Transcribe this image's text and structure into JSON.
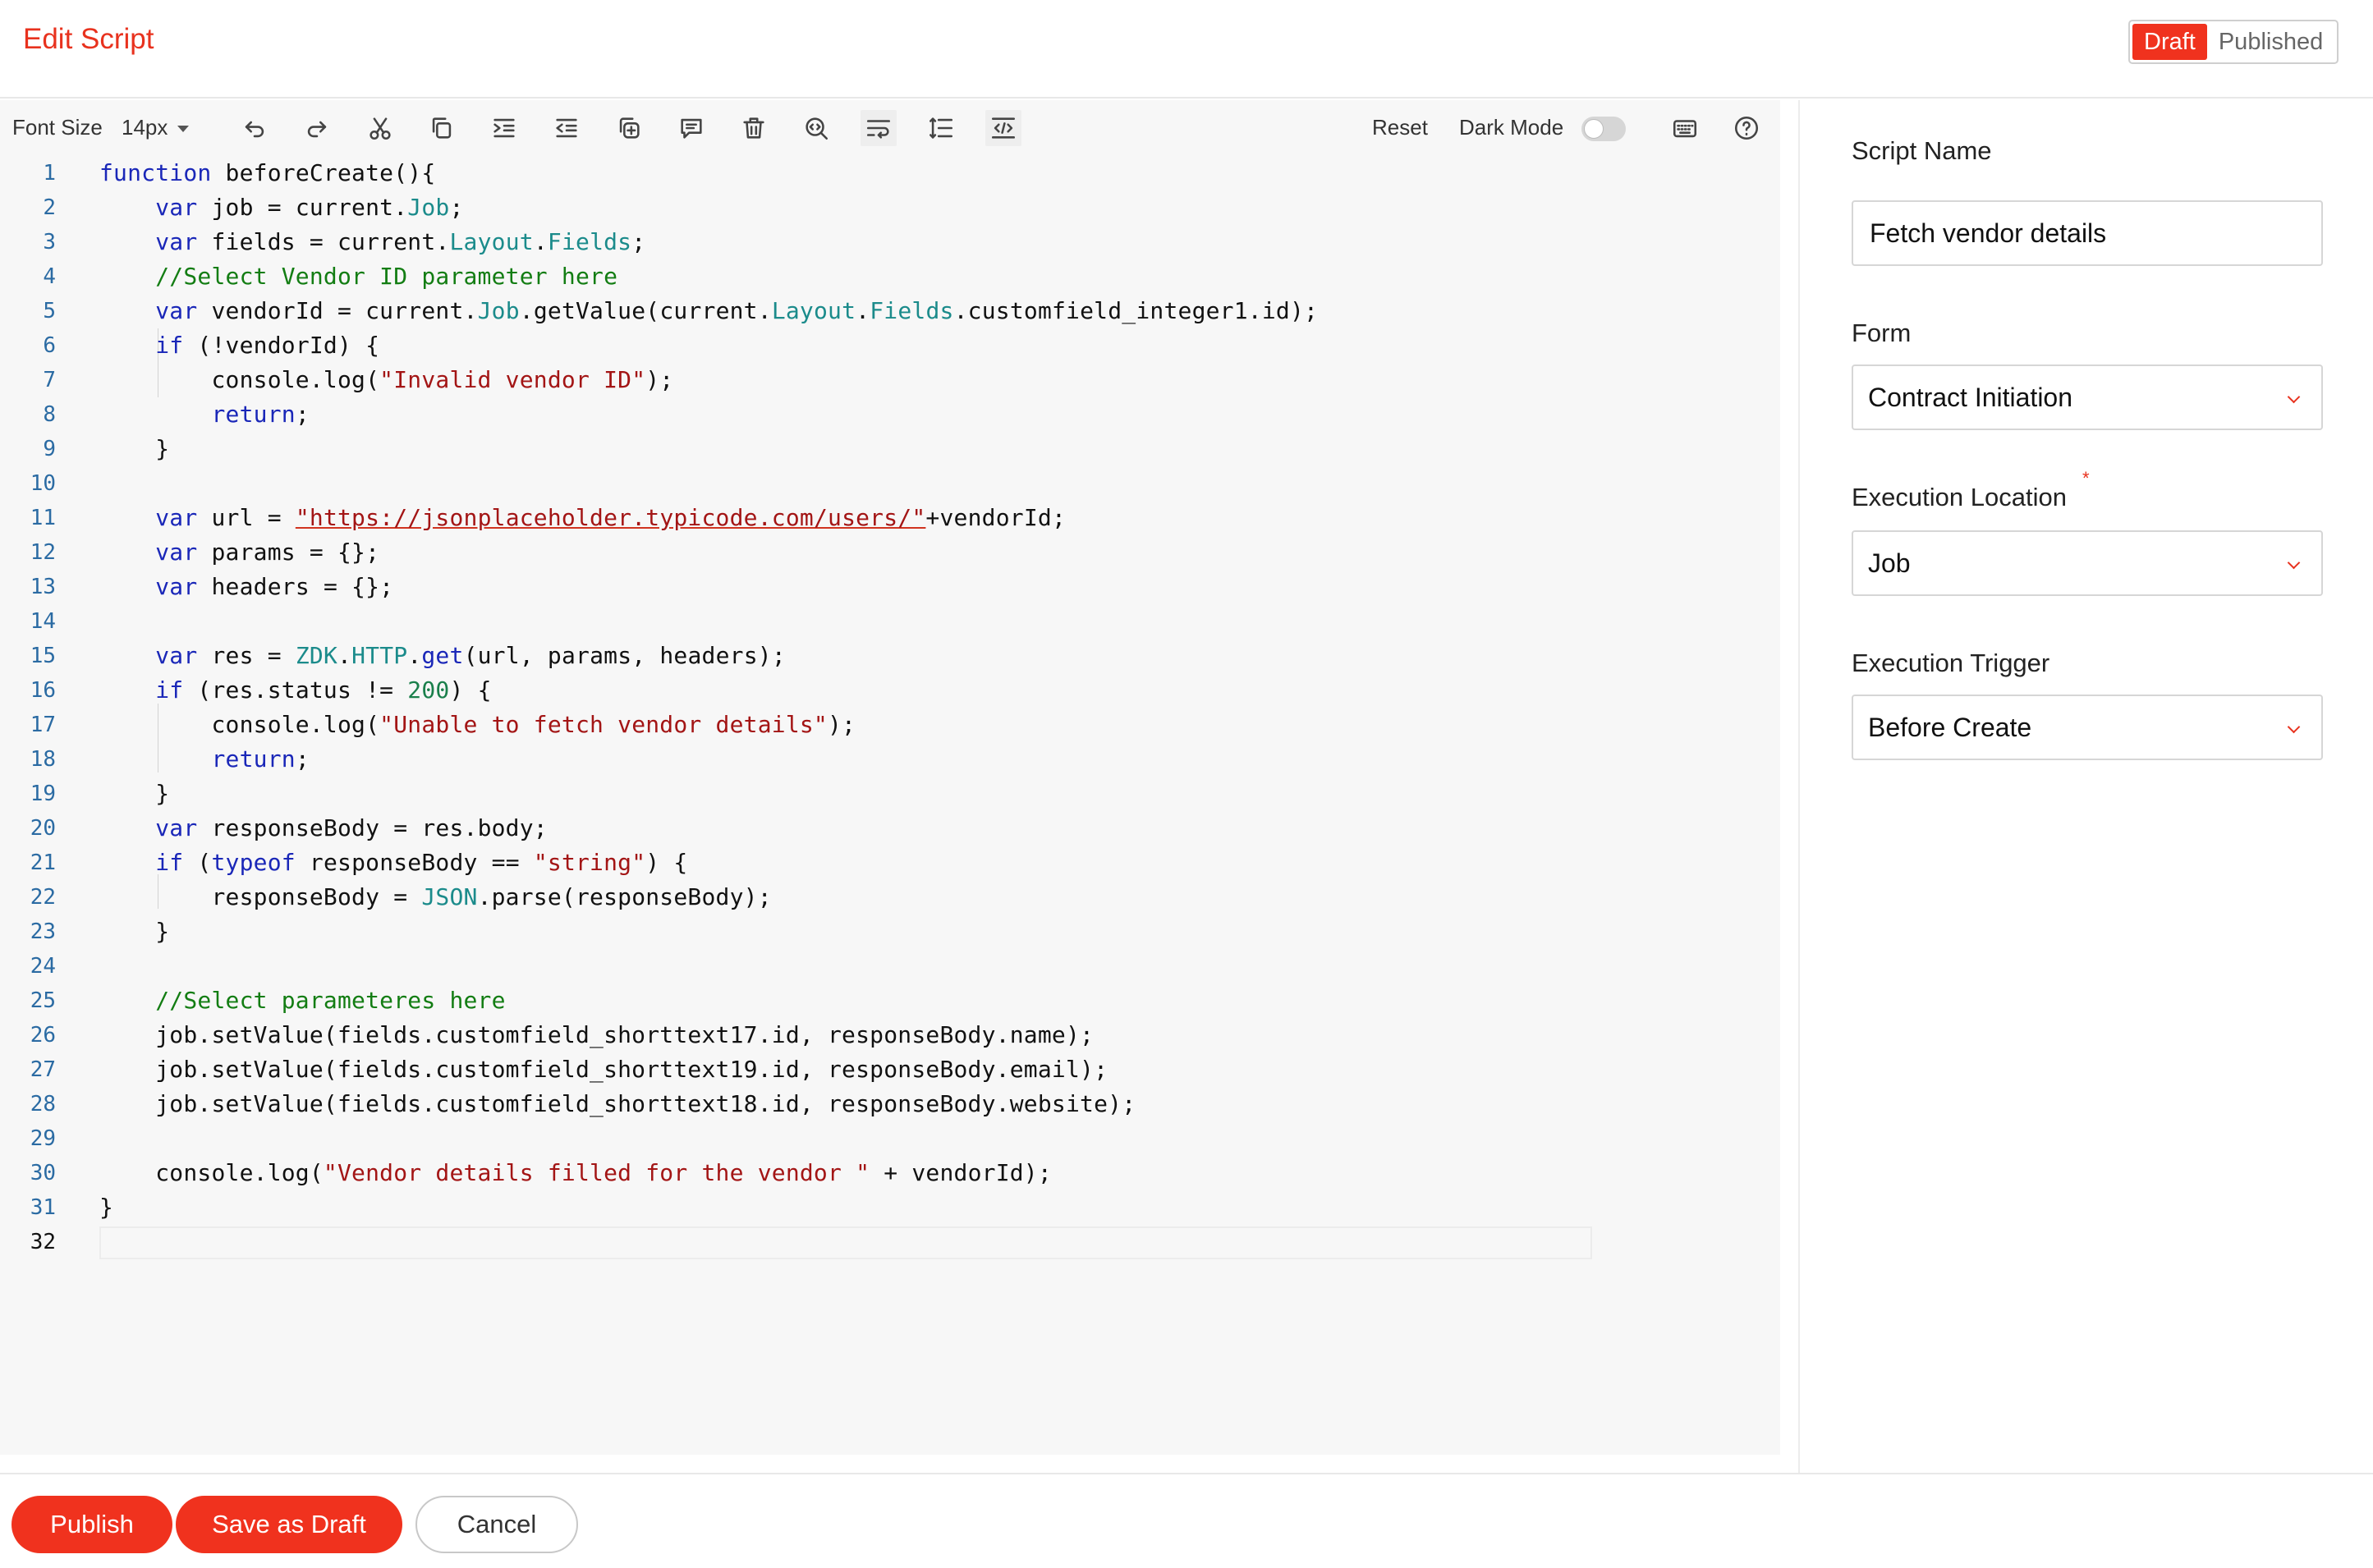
{
  "header": {
    "title": "Edit Script",
    "status_options": [
      "Draft",
      "Published"
    ],
    "active_status": "Draft"
  },
  "toolbar": {
    "font_size_label": "Font Size",
    "font_size_value": "14px",
    "reset_label": "Reset",
    "dark_mode_label": "Dark Mode",
    "dark_mode_on": false,
    "icons": [
      "undo-icon",
      "redo-icon",
      "cut-icon",
      "copy-icon",
      "indent-icon",
      "outdent-icon",
      "duplicate-icon",
      "comment-icon",
      "delete-icon",
      "find-icon",
      "wrap-icon",
      "line-spacing-icon",
      "code-tag-icon",
      "keyboard-icon",
      "help-icon"
    ]
  },
  "editor": {
    "current_line": 32,
    "lines": [
      [
        [
          "kw",
          "function"
        ],
        [
          "t",
          " beforeCreate(){"
        ]
      ],
      [
        [
          "t",
          "    "
        ],
        [
          "kw",
          "var"
        ],
        [
          "t",
          " job = current."
        ],
        [
          "ty",
          "Job"
        ],
        [
          "t",
          ";"
        ]
      ],
      [
        [
          "t",
          "    "
        ],
        [
          "kw",
          "var"
        ],
        [
          "t",
          " fields = current."
        ],
        [
          "ty",
          "Layout"
        ],
        [
          "t",
          "."
        ],
        [
          "ty",
          "Fields"
        ],
        [
          "t",
          ";"
        ]
      ],
      [
        [
          "t",
          "    "
        ],
        [
          "cm",
          "//Select Vendor ID parameter here"
        ]
      ],
      [
        [
          "t",
          "    "
        ],
        [
          "kw",
          "var"
        ],
        [
          "t",
          " vendorId = current."
        ],
        [
          "ty",
          "Job"
        ],
        [
          "t",
          ".getValue(current."
        ],
        [
          "ty",
          "Layout"
        ],
        [
          "t",
          "."
        ],
        [
          "ty",
          "Fields"
        ],
        [
          "t",
          ".customfield_integer1.id);"
        ]
      ],
      [
        [
          "t",
          "    "
        ],
        [
          "kw",
          "if"
        ],
        [
          "t",
          " (!vendorId) {"
        ]
      ],
      [
        [
          "t",
          "        console.log("
        ],
        [
          "st",
          "\"Invalid vendor ID\""
        ],
        [
          "t",
          ");"
        ]
      ],
      [
        [
          "t",
          "        "
        ],
        [
          "kw",
          "return"
        ],
        [
          "t",
          ";"
        ]
      ],
      [
        [
          "t",
          "    }"
        ]
      ],
      [
        [
          "t",
          ""
        ]
      ],
      [
        [
          "t",
          "    "
        ],
        [
          "kw",
          "var"
        ],
        [
          "t",
          " url = "
        ],
        [
          "ul",
          "\"https://jsonplaceholder.typicode.com/users/\""
        ],
        [
          "t",
          "+vendorId;"
        ]
      ],
      [
        [
          "t",
          "    "
        ],
        [
          "kw",
          "var"
        ],
        [
          "t",
          " params = {};"
        ]
      ],
      [
        [
          "t",
          "    "
        ],
        [
          "kw",
          "var"
        ],
        [
          "t",
          " headers = {};"
        ]
      ],
      [
        [
          "t",
          ""
        ]
      ],
      [
        [
          "t",
          "    "
        ],
        [
          "kw",
          "var"
        ],
        [
          "t",
          " res = "
        ],
        [
          "ty",
          "ZDK"
        ],
        [
          "t",
          "."
        ],
        [
          "ty",
          "HTTP"
        ],
        [
          "t",
          "."
        ],
        [
          "kw",
          "get"
        ],
        [
          "t",
          "(url, params, headers);"
        ]
      ],
      [
        [
          "t",
          "    "
        ],
        [
          "kw",
          "if"
        ],
        [
          "t",
          " (res.status != "
        ],
        [
          "nm",
          "200"
        ],
        [
          "t",
          ") {"
        ]
      ],
      [
        [
          "t",
          "        console.log("
        ],
        [
          "st",
          "\"Unable to fetch vendor details\""
        ],
        [
          "t",
          ");"
        ]
      ],
      [
        [
          "t",
          "        "
        ],
        [
          "kw",
          "return"
        ],
        [
          "t",
          ";"
        ]
      ],
      [
        [
          "t",
          "    }"
        ]
      ],
      [
        [
          "t",
          "    "
        ],
        [
          "kw",
          "var"
        ],
        [
          "t",
          " responseBody = res.body;"
        ]
      ],
      [
        [
          "t",
          "    "
        ],
        [
          "kw",
          "if"
        ],
        [
          "t",
          " ("
        ],
        [
          "kw",
          "typeof"
        ],
        [
          "t",
          " responseBody == "
        ],
        [
          "st",
          "\"string\""
        ],
        [
          "t",
          ") {"
        ]
      ],
      [
        [
          "t",
          "        responseBody = "
        ],
        [
          "ty",
          "JSON"
        ],
        [
          "t",
          ".parse(responseBody);"
        ]
      ],
      [
        [
          "t",
          "    }"
        ]
      ],
      [
        [
          "t",
          ""
        ]
      ],
      [
        [
          "t",
          "    "
        ],
        [
          "cm",
          "//Select parameteres here"
        ]
      ],
      [
        [
          "t",
          "    job.setValue(fields.customfield_shorttext17.id, responseBody.name);"
        ]
      ],
      [
        [
          "t",
          "    job.setValue(fields.customfield_shorttext19.id, responseBody.email);"
        ]
      ],
      [
        [
          "t",
          "    job.setValue(fields.customfield_shorttext18.id, responseBody.website);"
        ]
      ],
      [
        [
          "t",
          ""
        ]
      ],
      [
        [
          "t",
          "    console.log("
        ],
        [
          "st",
          "\"Vendor details filled for the vendor \""
        ],
        [
          "t",
          " + vendorId);"
        ]
      ],
      [
        [
          "t",
          "}"
        ]
      ],
      [
        [
          "t",
          ""
        ]
      ]
    ]
  },
  "side_panel": {
    "script_name_label": "Script Name",
    "script_name_value": "Fetch vendor details",
    "form_label": "Form",
    "form_value": "Contract Initiation",
    "execution_location_label": "Execution Location",
    "execution_location_required": "*",
    "execution_location_value": "Job",
    "execution_trigger_label": "Execution Trigger",
    "execution_trigger_value": "Before Create"
  },
  "footer": {
    "publish_label": "Publish",
    "save_draft_label": "Save as Draft",
    "cancel_label": "Cancel"
  },
  "colors": {
    "accent": "#f0321e",
    "keyword": "#1a27b8",
    "comment": "#137d13",
    "string": "#a31515",
    "type": "#1b8b8b",
    "line_number": "#2b6ba3"
  }
}
